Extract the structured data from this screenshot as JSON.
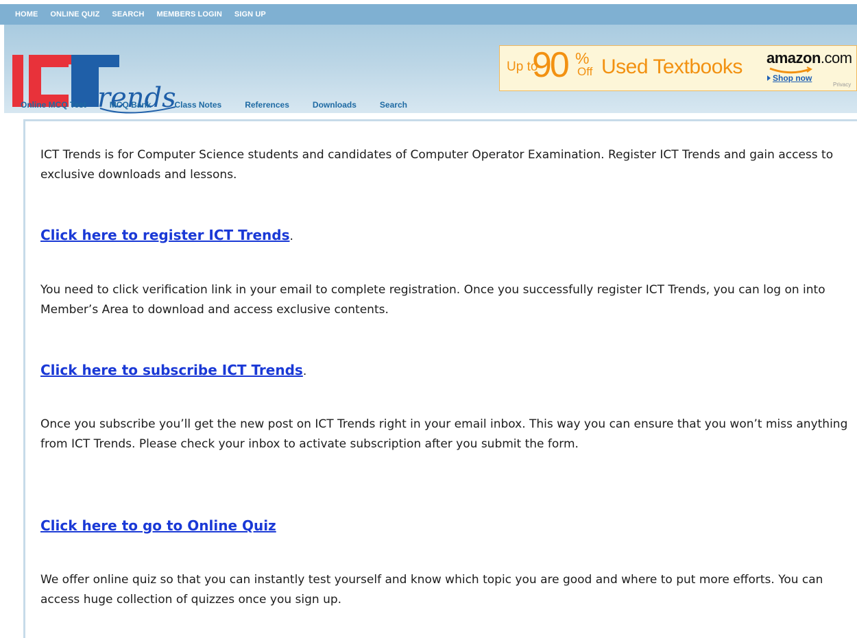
{
  "top_nav": [
    "HOME",
    "ONLINE QUIZ",
    "SEARCH",
    "MEMBERS LOGIN",
    "SIGN UP"
  ],
  "logo": {
    "text": "ICT Trends",
    "script": "rends"
  },
  "ad": {
    "up_to": "Up to",
    "percent": "90",
    "percent_sign": "%",
    "off": "Off",
    "headline": "Used Textbooks",
    "brand": "amazon",
    "brand_suffix": ".com",
    "shop_now": "Shop now",
    "privacy": "Privacy"
  },
  "nav": [
    "Online MCQ Test",
    "MCQ Bank",
    "Class Notes",
    "References",
    "Downloads",
    "Search"
  ],
  "content": {
    "intro": "ICT Trends is for Computer Science students and candidates of Computer Operator Examination. Register ICT Trends and gain access to exclusive downloads and lessons.",
    "register_link": "Click here to register ICT Trends",
    "register_after": ".",
    "verification": "You need to click verification link in your email to complete registration. Once you successfully register ICT Trends, you can log on into Member’s Area to download and access exclusive contents.",
    "subscribe_link": "Click here to subscribe ICT Trends",
    "subscribe_after": ".",
    "subscribe_text": "Once you subscribe you’ll get the new post on ICT Trends right in your email inbox. This way you can ensure that you won’t miss anything from ICT Trends. Please check your inbox to activate subscription after you submit the form.",
    "quiz_link": "Click here to go to Online Quiz",
    "quiz_text": "We offer online quiz so that you can instantly test yourself and know which topic you are good and where to put more efforts. You can access huge collection of quizzes once you sign up."
  },
  "colors": {
    "topbar": "#7fb0d2",
    "nav_link": "#1e6aa3",
    "content_link": "#1a39d6",
    "logo_red": "#e8323a",
    "logo_blue": "#1f5fa8"
  }
}
